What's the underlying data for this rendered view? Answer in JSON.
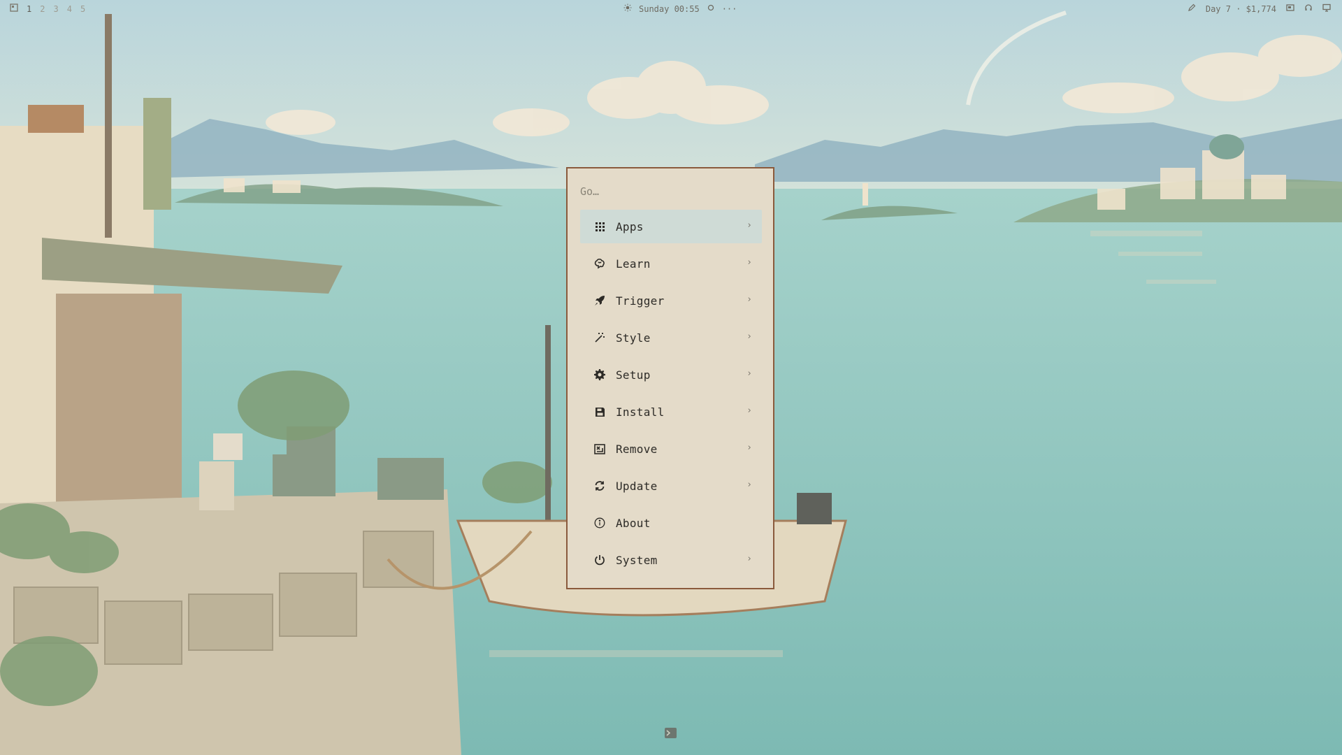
{
  "topbar": {
    "workspaces": [
      "1",
      "2",
      "3",
      "4",
      "5"
    ],
    "active_workspace": "1",
    "datetime": "Sunday 00:55",
    "overflow": "···",
    "status_text": "Day 7 · $1,774",
    "icons": [
      "workspace-switcher-icon",
      "weather-icon",
      "record-icon",
      "pencil-icon",
      "screen-icon",
      "headphones-icon",
      "display-icon"
    ]
  },
  "launcher": {
    "search_placeholder": "Go…",
    "items": [
      {
        "label": "Apps",
        "icon": "grid-icon",
        "selected": true,
        "chevron": "›"
      },
      {
        "label": "Learn",
        "icon": "brain-icon",
        "selected": false,
        "chevron": "›"
      },
      {
        "label": "Trigger",
        "icon": "rocket-icon",
        "selected": false,
        "chevron": "›"
      },
      {
        "label": "Style",
        "icon": "magic-wand-icon",
        "selected": false,
        "chevron": "›"
      },
      {
        "label": "Setup",
        "icon": "gear-icon",
        "selected": false,
        "chevron": "›"
      },
      {
        "label": "Install",
        "icon": "floppy-icon",
        "selected": false,
        "chevron": "›"
      },
      {
        "label": "Remove",
        "icon": "remove-box-icon",
        "selected": false,
        "chevron": "›"
      },
      {
        "label": "Update",
        "icon": "refresh-icon",
        "selected": false,
        "chevron": "›"
      },
      {
        "label": "About",
        "icon": "info-icon",
        "selected": false,
        "chevron": ""
      },
      {
        "label": "System",
        "icon": "power-icon",
        "selected": false,
        "chevron": "›"
      }
    ]
  },
  "colors": {
    "menu_bg": "#e4dbc9",
    "menu_border": "#8a5a3c",
    "selected_bg": "#cfdbd6",
    "text": "#2d2b27"
  }
}
